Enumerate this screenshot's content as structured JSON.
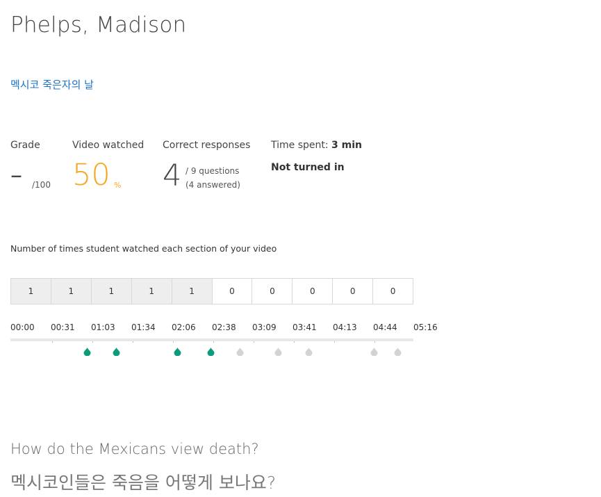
{
  "student": {
    "name": "Phelps, Madison"
  },
  "lesson": {
    "title": "멕시코 죽은자의 날"
  },
  "stats": {
    "grade": {
      "label": "Grade",
      "value": "–",
      "denominator": "/100"
    },
    "video": {
      "label": "Video watched",
      "value": "50",
      "unit": "%"
    },
    "correct": {
      "label": "Correct responses",
      "value": "4",
      "total": "/ 9 questions",
      "answered": "(4 answered)"
    },
    "time": {
      "label": "Time spent:",
      "value": "3 min",
      "status": "Not turned in"
    }
  },
  "colors": {
    "accent_orange": "#f5a623",
    "link_blue": "#1a73c9",
    "marker_green": "#0e9b7a",
    "marker_gray": "#d3d3d3"
  },
  "chart_data": {
    "type": "table",
    "title": "Number of times student watched each section of your video",
    "segments": [
      {
        "count": "1",
        "watched": true
      },
      {
        "count": "1",
        "watched": true
      },
      {
        "count": "1",
        "watched": true
      },
      {
        "count": "1",
        "watched": true
      },
      {
        "count": "1",
        "watched": true
      },
      {
        "count": "0",
        "watched": false
      },
      {
        "count": "0",
        "watched": false
      },
      {
        "count": "0",
        "watched": false
      },
      {
        "count": "0",
        "watched": false
      },
      {
        "count": "0",
        "watched": false
      }
    ],
    "tick_labels": [
      "00:00",
      "00:31",
      "01:03",
      "01:34",
      "02:06",
      "02:38",
      "03:09",
      "03:41",
      "04:13",
      "04:44",
      "05:16"
    ],
    "video_length_seconds": 316,
    "markers": [
      {
        "time_seconds": 60,
        "answered": true
      },
      {
        "time_seconds": 83,
        "answered": true
      },
      {
        "time_seconds": 131,
        "answered": true
      },
      {
        "time_seconds": 157,
        "answered": true
      },
      {
        "time_seconds": 180,
        "answered": false
      },
      {
        "time_seconds": 210,
        "answered": false
      },
      {
        "time_seconds": 234,
        "answered": false
      },
      {
        "time_seconds": 285,
        "answered": false
      },
      {
        "time_seconds": 304,
        "answered": false
      }
    ]
  },
  "question": {
    "english": "How do the Mexicans view death?",
    "korean": "멕시코인들은 죽음을 어떻게 보나요?"
  }
}
